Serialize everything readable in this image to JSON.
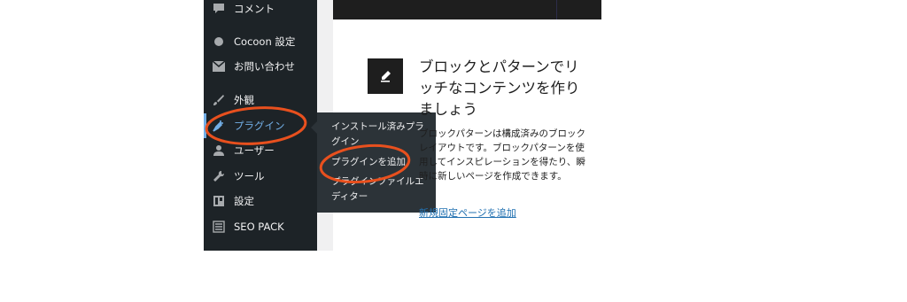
{
  "menu": {
    "items": [
      {
        "label": "コメント",
        "icon": "comment-icon"
      },
      {
        "label": "Cocoon 設定",
        "icon": "circle-icon"
      },
      {
        "label": "お問い合わせ",
        "icon": "mail-icon"
      },
      {
        "label": "外観",
        "icon": "brush-icon"
      },
      {
        "label": "プラグイン",
        "icon": "plugin-icon"
      },
      {
        "label": "ユーザー",
        "icon": "user-icon"
      },
      {
        "label": "ツール",
        "icon": "wrench-icon"
      },
      {
        "label": "設定",
        "icon": "settings-icon"
      },
      {
        "label": "SEO PACK",
        "icon": "list-icon"
      }
    ]
  },
  "flyout": {
    "installed": "インストール済みプラグイン",
    "add_new": "プラグインを追加",
    "editor": "プラグインファイルエディター"
  },
  "card": {
    "title": "ブロックとパターンでリッチなコンテンツを作りましょう",
    "text": "ブロックパターンは構成済みのブロックレイアウトです。ブロックパターンを使用してインスピレーションを得たり、瞬時に新しいページを作成できます。",
    "link": "新規固定ページを追加",
    "icon": "pencil-icon"
  },
  "colors": {
    "sidebar_bg": "#1d2327",
    "flyout_bg": "#2c3338",
    "active_text": "#72aee6",
    "annotation": "#e8501e",
    "link": "#2271b1"
  }
}
